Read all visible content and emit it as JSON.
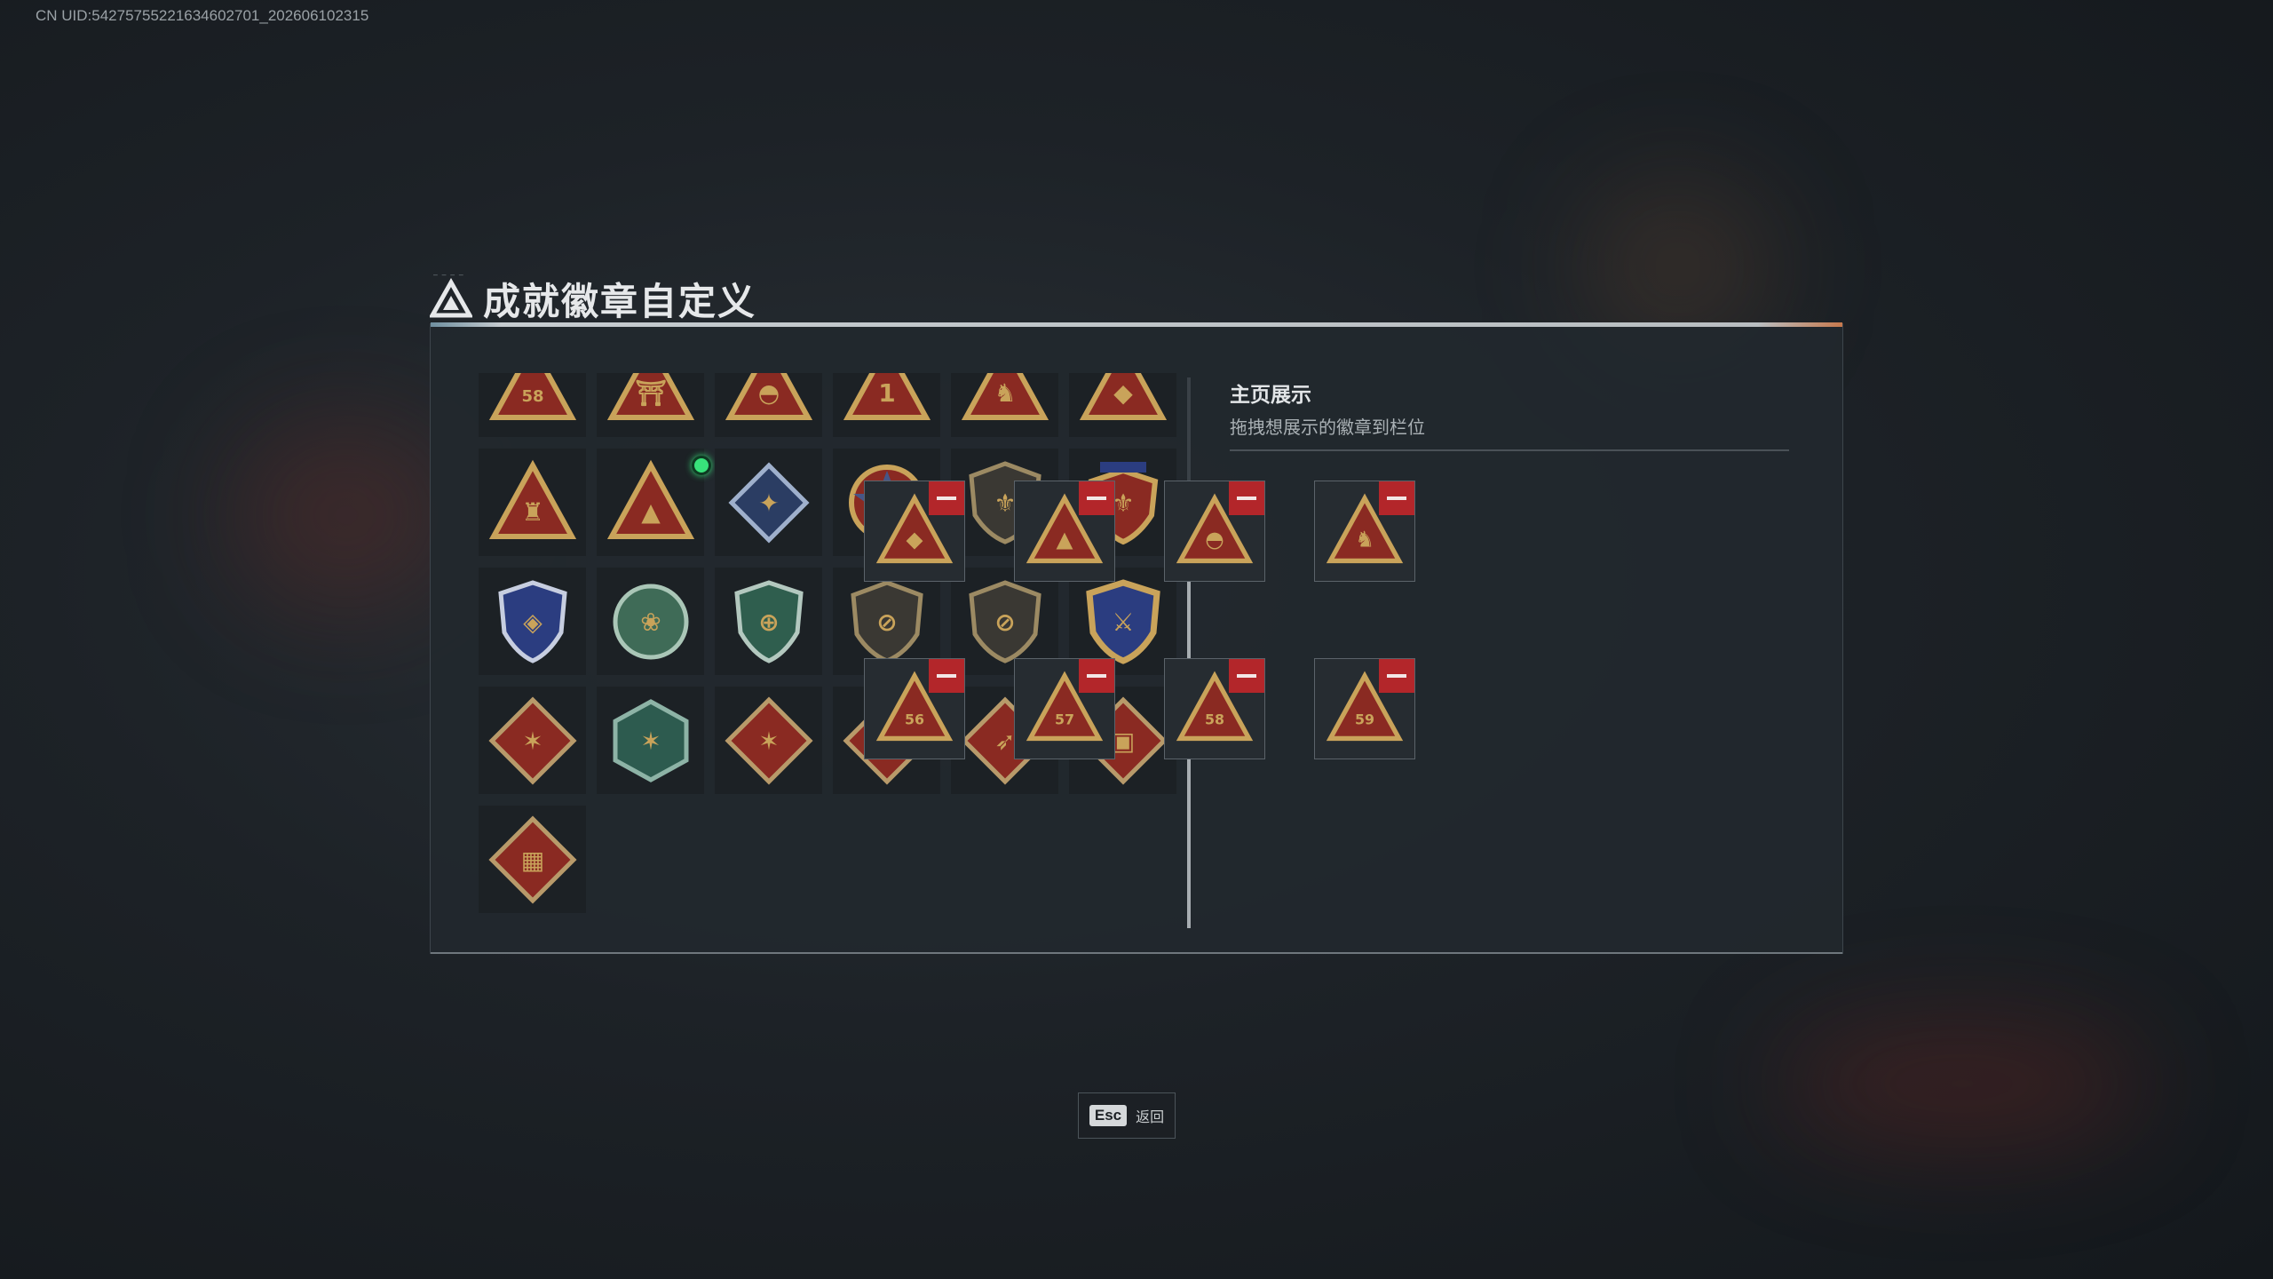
{
  "uid_text": "CN UID:54275755221634602701_202606102315",
  "window": {
    "title": "成就徽章自定义",
    "title_sub_tiny": "— — — —"
  },
  "badge_grid": [
    {
      "name": "badge-triangle-58",
      "kind": "triangle",
      "glyph": "58",
      "new": true
    },
    {
      "name": "badge-triangle-tower",
      "kind": "triangle",
      "glyph": "⛩",
      "new": true
    },
    {
      "name": "badge-triangle-dome",
      "kind": "triangle",
      "glyph": "◓",
      "new": true
    },
    {
      "name": "badge-triangle-1",
      "kind": "triangle",
      "glyph": "1",
      "new": false
    },
    {
      "name": "badge-triangle-figure",
      "kind": "triangle",
      "glyph": "♞",
      "new": true
    },
    {
      "name": "badge-triangle-gem",
      "kind": "triangle",
      "glyph": "◆",
      "new": true
    },
    {
      "name": "badge-triangle-soldier",
      "kind": "triangle",
      "glyph": "♜",
      "new": false
    },
    {
      "name": "badge-triangle-rocket",
      "kind": "triangle",
      "glyph": "▲",
      "new": true
    },
    {
      "name": "badge-diamond-rifle",
      "kind": "blue-diamond",
      "glyph": "✦",
      "new": false
    },
    {
      "name": "badge-star-medal",
      "kind": "star",
      "glyph": "★",
      "new": false
    },
    {
      "name": "badge-shield-dark",
      "kind": "dark-shield",
      "glyph": "⚜",
      "new": false
    },
    {
      "name": "badge-shield-crest",
      "kind": "crest",
      "glyph": "⚜",
      "new": false
    },
    {
      "name": "badge-shield-blue",
      "kind": "blue-shield",
      "glyph": "◈",
      "new": false
    },
    {
      "name": "badge-shield-green-rose",
      "kind": "green-round",
      "glyph": "❀",
      "new": false
    },
    {
      "name": "badge-shield-green-crosshair",
      "kind": "green-shield",
      "glyph": "⊕",
      "new": false
    },
    {
      "name": "badge-shield-rifle-1",
      "kind": "dark-shield",
      "glyph": "⊘",
      "new": false
    },
    {
      "name": "badge-shield-rifle-2",
      "kind": "dark-shield",
      "glyph": "⊘",
      "new": false
    },
    {
      "name": "badge-shield-gold-wings",
      "kind": "gold-shield",
      "glyph": "⚔",
      "new": false
    },
    {
      "name": "badge-diamond-wolf",
      "kind": "red-diamond",
      "glyph": "✶",
      "new": false
    },
    {
      "name": "badge-hex-dragon",
      "kind": "green-hex",
      "glyph": "✶",
      "new": false
    },
    {
      "name": "badge-diamond-dragon-1",
      "kind": "red-diamond",
      "glyph": "✶",
      "new": false
    },
    {
      "name": "badge-diamond-dragon-2",
      "kind": "red-diamond",
      "glyph": "✶",
      "new": false
    },
    {
      "name": "badge-diamond-runner",
      "kind": "red-diamond",
      "glyph": "➶",
      "new": false
    },
    {
      "name": "badge-diamond-vehicle",
      "kind": "red-diamond",
      "glyph": "▣",
      "new": false
    },
    {
      "name": "badge-diamond-vest",
      "kind": "red-diamond",
      "glyph": "▦",
      "new": false
    }
  ],
  "showcase": {
    "title": "主页展示",
    "subtitle": "拖拽想展示的徽章到栏位",
    "slots": [
      {
        "name": "slot-1-gem",
        "glyph": "◆"
      },
      {
        "name": "slot-2-rocket",
        "glyph": "▲"
      },
      {
        "name": "slot-3-dome",
        "glyph": "◓"
      },
      {
        "name": "slot-4-figure",
        "glyph": "♞"
      },
      {
        "name": "slot-5-56",
        "glyph": "56"
      },
      {
        "name": "slot-6-57",
        "glyph": "57"
      },
      {
        "name": "slot-7-58",
        "glyph": "58"
      },
      {
        "name": "slot-8-59",
        "glyph": "59"
      }
    ]
  },
  "footer": {
    "esc_key": "Esc",
    "esc_label": "返回"
  },
  "colors": {
    "gold": "#c9a35a",
    "badge_red": "#8a2a22",
    "remove_red": "#b3262a",
    "new_dot": "#38e27a"
  }
}
